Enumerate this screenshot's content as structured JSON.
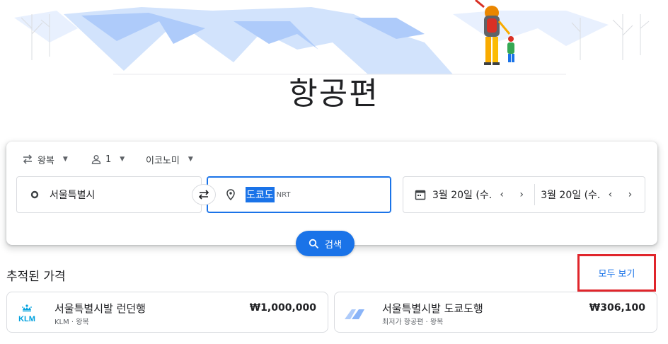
{
  "page_title": "항공편",
  "search": {
    "trip_type": "왕복",
    "passengers": "1",
    "cabin_class": "이코노미",
    "origin": "서울특별시",
    "destination_selected": "도쿄도",
    "destination_code": "NRT",
    "depart_date": "3월 20일 (수.",
    "return_date": "3월 20일 (수.",
    "search_button_label": "검색"
  },
  "tracked": {
    "section_title": "추적된 가격",
    "see_all_label": "모두 보기",
    "cards": [
      {
        "route": "서울특별시발 런던행",
        "subtitle": "KLM · 왕복",
        "price": "₩1,000,000",
        "logo_text": "KLM"
      },
      {
        "route": "서울특별시발 도쿄도행",
        "subtitle": "최저가 항공편 · 왕복",
        "price": "₩306,100"
      }
    ]
  },
  "colors": {
    "accent": "#1a73e8",
    "highlight_border": "#e0252b",
    "klm_blue": "#00a1de"
  }
}
